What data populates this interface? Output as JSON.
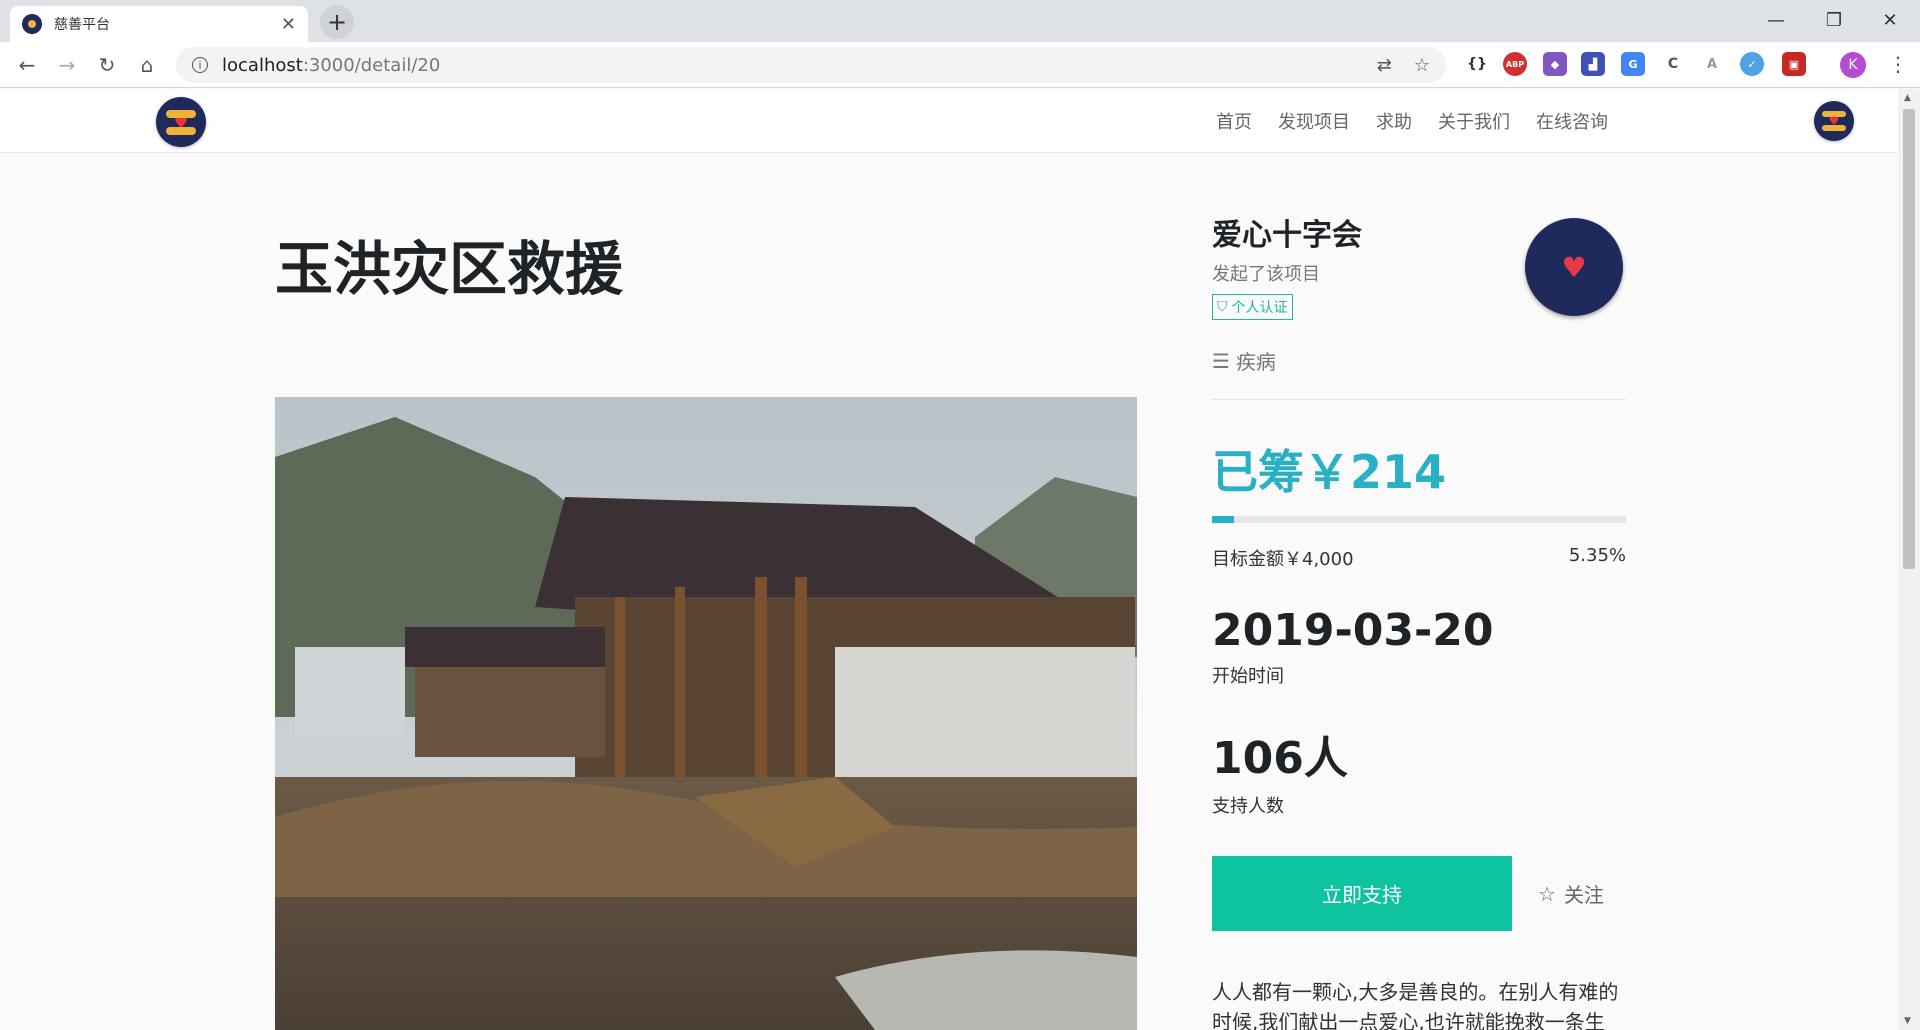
{
  "browser": {
    "tab_title": "慈善平台",
    "url_host": "localhost",
    "url_path": ":3000/detail/20",
    "profile_initial": "K"
  },
  "header": {
    "nav": [
      "首页",
      "发现项目",
      "求助",
      "关于我们",
      "在线咨询"
    ]
  },
  "project": {
    "title": "玉洪灾区救援"
  },
  "organizer": {
    "name": "爱心十字会",
    "subtitle": "发起了该项目",
    "badge": "个人认证",
    "category": "疾病"
  },
  "funding": {
    "raised_label": "已筹￥214",
    "raised_amount": 214,
    "goal_label": "目标金额￥4,000",
    "goal_amount": 4000,
    "percent_label": "5.35%",
    "progress_fraction": 0.0535
  },
  "stats": {
    "start_date": "2019-03-20",
    "start_label": "开始时间",
    "supporters": "106人",
    "supporters_label": "支持人数"
  },
  "actions": {
    "support": "立即支持",
    "follow": "关注"
  },
  "description": "人人都有一颗心,大多是善良的。在别人有难的时候,我们献出一点爱心,也许就能挽救一条生命。",
  "colors": {
    "accent": "#2ab0c5",
    "button": "#0ec3a0",
    "badge": "#1fb8a5",
    "logo_bg": "#1f2a5c"
  }
}
